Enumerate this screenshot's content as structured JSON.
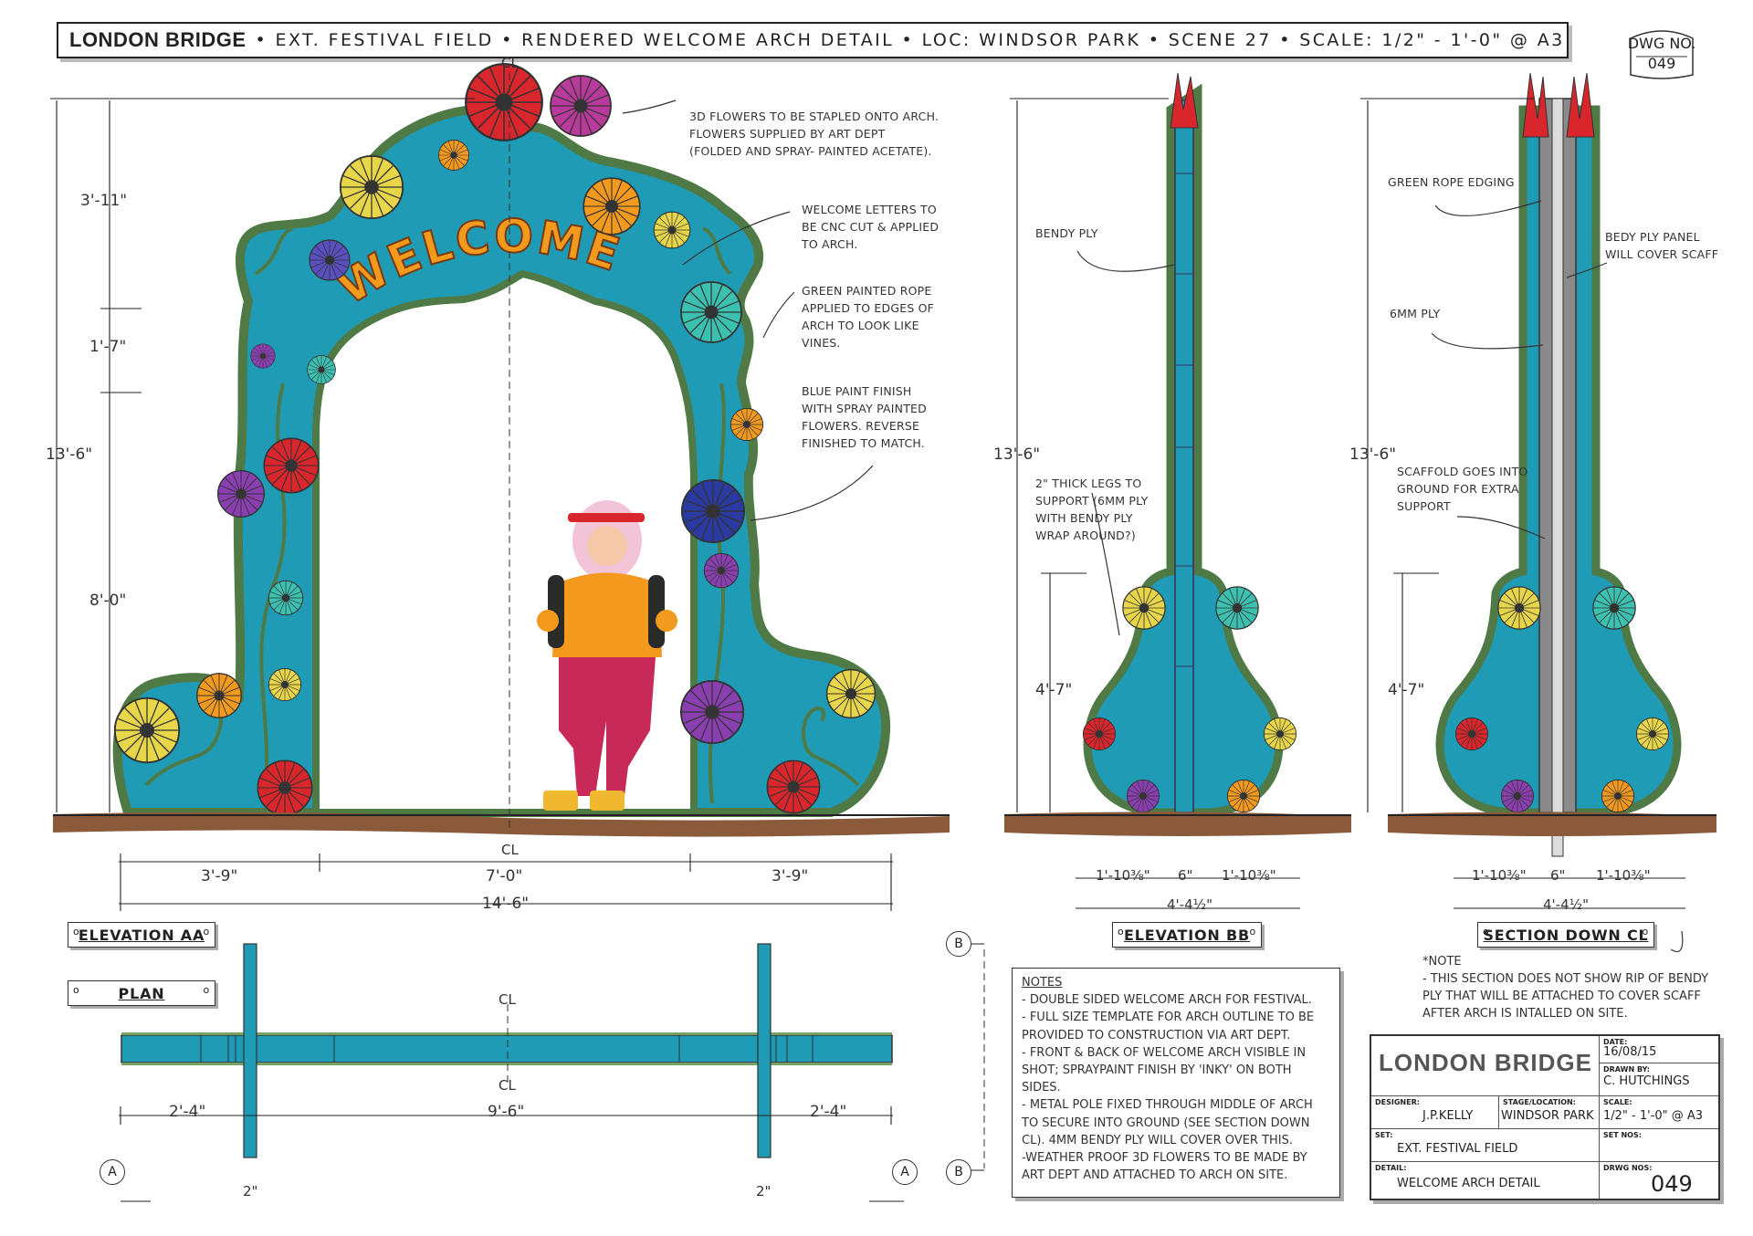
{
  "header": {
    "project": "LONDON BRIDGE",
    "details": "• EXT. FESTIVAL FIELD  • RENDERED WELCOME ARCH DETAIL  • LOC: WINDSOR PARK  • SCENE 27  • SCALE: 1/2\" - 1'-0\" @ A3",
    "dwg_label": "DWG NO.",
    "dwg_number": "049"
  },
  "centerline": "CL",
  "arch_word": "WELCOME",
  "elevation_aa": {
    "title": "ELEVATION AA",
    "dims_vertical": [
      "3'-11\"",
      "1'-7\"",
      "13'-6\"",
      "8'-0\""
    ],
    "dims_horizontal": [
      "3'-9\"",
      "7'-0\"",
      "3'-9\"",
      "14'-6\""
    ],
    "notes": [
      "3D FLOWERS TO BE STAPLED ONTO ARCH.\nFLOWERS SUPPLIED BY ART DEPT\n(FOLDED AND SPRAY- PAINTED ACETATE).",
      "WELCOME LETTERS TO\nBE CNC CUT & APPLIED\nTO ARCH.",
      "GREEN PAINTED ROPE\nAPPLIED TO EDGES OF\nARCH  TO LOOK LIKE\nVINES.",
      "BLUE PAINT FINISH\nWITH SPRAY PAINTED\nFLOWERS. REVERSE\nFINISHED TO MATCH."
    ]
  },
  "elevation_bb": {
    "title": "ELEVATION BB",
    "dims": [
      "13'-6\"",
      "4'-7\"",
      "1'-10⅜\"",
      "6\"",
      "1'-10⅜\"",
      "4'-4½\""
    ],
    "notes": [
      "BENDY PLY",
      "2\" THICK LEGS TO\nSUPPORT (6MM PLY\nWITH BENDY PLY\nWRAP AROUND?)"
    ]
  },
  "section_cl": {
    "title": "SECTION DOWN CL",
    "dims": [
      "13'-6\"",
      "4'-7\"",
      "1'-10⅜\"",
      "6\"",
      "1'-10⅜\"",
      "4'-4½\""
    ],
    "notes": [
      "GREEN ROPE EDGING",
      "BEDY PLY PANEL\nWILL COVER SCAFF",
      "6MM PLY",
      "SCAFFOLD GOES INTO\nGROUND FOR EXTRA\nSUPPORT"
    ],
    "footnote": "*NOTE\n- THIS SECTION DOES NOT SHOW RIP OF BENDY\nPLY THAT WILL BE ATTACHED TO COVER SCAFF\nAFTER ARCH IS INTALLED ON SITE."
  },
  "plan": {
    "title": "PLAN",
    "dims": [
      "2'-4\"",
      "9'-6\"",
      "2'-4\"",
      "2\"",
      "2\""
    ],
    "markers": [
      "A",
      "A",
      "B",
      "B"
    ]
  },
  "notes": {
    "heading": "NOTES",
    "items": [
      "- DOUBLE SIDED WELCOME ARCH FOR FESTIVAL.",
      "- FULL SIZE TEMPLATE FOR ARCH OUTLINE TO BE PROVIDED TO CONSTRUCTION VIA ART DEPT.",
      "- FRONT & BACK OF WELCOME ARCH VISIBLE IN SHOT; SPRAYPAINT FINISH BY 'INKY' ON BOTH SIDES.",
      "- METAL POLE FIXED THROUGH MIDDLE OF ARCH TO SECURE INTO GROUND (SEE SECTION DOWN CL). 4MM BENDY PLY WILL COVER OVER THIS.",
      "-WEATHER PROOF 3D FLOWERS TO BE MADE BY ART DEPT AND ATTACHED TO ARCH ON SITE."
    ]
  },
  "title_block": {
    "project": "LONDON BRIDGE",
    "date_label": "DATE:",
    "date": "16/08/15",
    "drawn_label": "DRAWN BY:",
    "drawn_by": "C. HUTCHINGS",
    "designer_label": "DESIGNER:",
    "designer": "J.P.KELLY",
    "location_label": "STAGE/LOCATION:",
    "location": "WINDSOR PARK",
    "scale_label": "SCALE:",
    "scale": "1/2\" - 1'-0\" @ A3",
    "set_label": "SET:",
    "set": "EXT. FESTIVAL FIELD",
    "setnos_label": "SET NOS:",
    "detail_label": "DETAIL:",
    "detail": "WELCOME ARCH DETAIL",
    "drwgnos_label": "DRWG NOS:",
    "drwg": "049"
  },
  "colors": {
    "arch_blue": "#1f9bb5",
    "vine_green": "#6f9a5a",
    "ground_brown": "#8a5a3a",
    "letters_orange": "#f39a1e",
    "flower_red": "#d8262c",
    "flower_purple": "#8a3fb0",
    "flower_yellow": "#e8d64a",
    "flower_teal": "#3cc0b0"
  }
}
